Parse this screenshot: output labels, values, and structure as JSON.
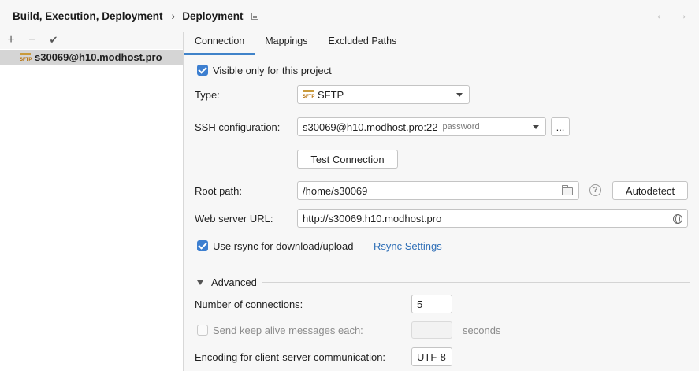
{
  "breadcrumb": {
    "parent": "Build, Execution, Deployment",
    "separator": "›",
    "current": "Deployment"
  },
  "nav": {
    "back": "←",
    "forward": "→"
  },
  "left_toolbar": {
    "add": "+",
    "remove": "−",
    "apply": "✔"
  },
  "servers": [
    {
      "badge": "SFTP",
      "name": "s30069@h10.modhost.pro"
    }
  ],
  "tabs": [
    {
      "label": "Connection",
      "active": true
    },
    {
      "label": "Mappings",
      "active": false
    },
    {
      "label": "Excluded Paths",
      "active": false
    }
  ],
  "connection": {
    "visible_only_label": "Visible only for this project",
    "visible_only_checked": true,
    "type_label": "Type:",
    "type_badge": "SFTP",
    "type_value": "SFTP",
    "ssh_label": "SSH configuration:",
    "ssh_value": "s30069@h10.modhost.pro:22",
    "ssh_hint": "password",
    "ssh_more": "...",
    "test_button": "Test Connection",
    "root_path_label": "Root path:",
    "root_path_value": "/home/s30069",
    "help": "?",
    "autodetect_button": "Autodetect",
    "web_url_label": "Web server URL:",
    "web_url_value": "http://s30069.h10.modhost.pro",
    "rsync_label": "Use rsync for download/upload",
    "rsync_checked": true,
    "rsync_settings_link": "Rsync Settings"
  },
  "advanced": {
    "title": "Advanced",
    "connections_label": "Number of connections:",
    "connections_value": "5",
    "keepalive_label": "Send keep alive messages each:",
    "keepalive_checked": false,
    "keepalive_value": "",
    "keepalive_unit": "seconds",
    "encoding_label": "Encoding for client-server communication:",
    "encoding_value": "UTF-8"
  },
  "colors": {
    "accent": "#3d7fd0",
    "link": "#2f6fb7",
    "selection": "#d5d5d5"
  }
}
